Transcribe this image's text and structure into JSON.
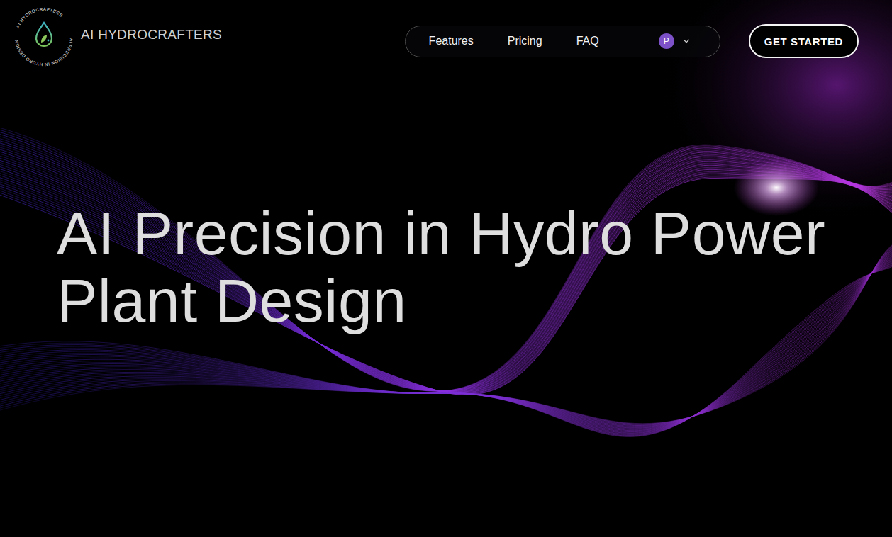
{
  "logo": {
    "ring_top": "AI HYDROCRAFTERS",
    "ring_bottom": "AI PRECISION IN HYDRO DESIGN"
  },
  "brand": "AI HYDROCRAFTERS",
  "nav": {
    "items": [
      {
        "label": "Features"
      },
      {
        "label": "Pricing"
      },
      {
        "label": "FAQ"
      }
    ],
    "account": {
      "initial": "P"
    }
  },
  "cta": "GET STARTED",
  "hero": {
    "title": "AI Precision in Hydro Power Plant Design"
  }
}
